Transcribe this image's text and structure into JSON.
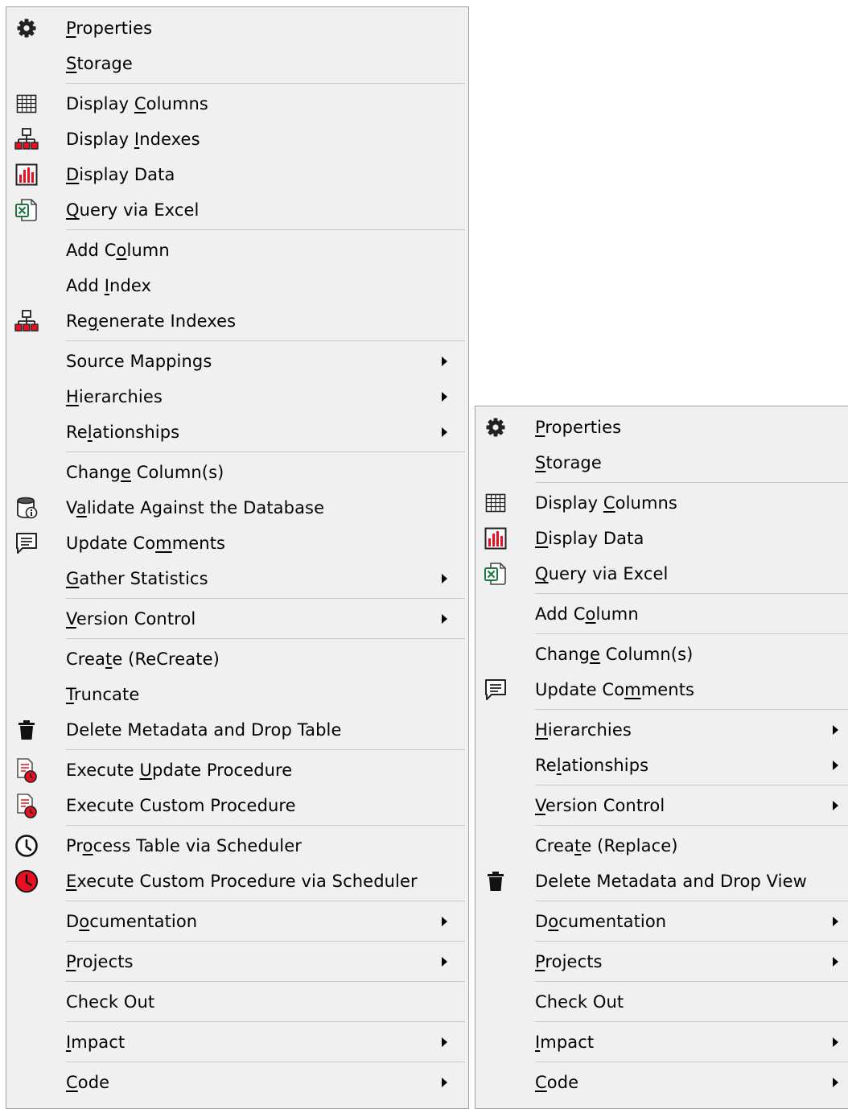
{
  "colors": {
    "menu_bg": "#f0f0f0",
    "border": "#a0a0a0",
    "separator": "#c8c8c8",
    "text": "#000000",
    "accent_red": "#e81123",
    "excel_green": "#217346"
  },
  "menus": [
    {
      "name": "table-context-menu",
      "items": [
        {
          "label": "Properties",
          "u": 0,
          "icon": "gear-icon"
        },
        {
          "label": "Storage",
          "u": 0,
          "icon": ""
        },
        {
          "sep": true
        },
        {
          "label": "Display Columns",
          "u": 8,
          "icon": "grid-icon"
        },
        {
          "label": "Display Indexes",
          "u": 8,
          "icon": "hierarchy-icon"
        },
        {
          "label": "Display Data",
          "u": 0,
          "icon": "bar-chart-icon"
        },
        {
          "label": "Query via Excel",
          "u": 0,
          "icon": "excel-icon"
        },
        {
          "sep": true
        },
        {
          "label": "Add Column",
          "u": 5,
          "icon": ""
        },
        {
          "label": "Add Index",
          "u": 4,
          "icon": ""
        },
        {
          "label": "Regenerate Indexes",
          "u": 2,
          "icon": "hierarchy-icon"
        },
        {
          "sep": true
        },
        {
          "label": "Source Mappings",
          "u": -1,
          "icon": "",
          "submenu": true
        },
        {
          "label": "Hierarchies",
          "u": 0,
          "icon": "",
          "submenu": true
        },
        {
          "label": "Relationships",
          "u": 2,
          "icon": "",
          "submenu": true
        },
        {
          "sep": true
        },
        {
          "label": "Change Column(s)",
          "u": 5,
          "icon": ""
        },
        {
          "label": "Validate Against the Database",
          "u": 1,
          "icon": "database-info-icon"
        },
        {
          "label": "Update Comments",
          "u": 9,
          "icon": "comment-icon"
        },
        {
          "label": "Gather Statistics",
          "u": 0,
          "icon": "",
          "submenu": true
        },
        {
          "sep": true
        },
        {
          "label": "Version Control",
          "u": 0,
          "icon": "",
          "submenu": true
        },
        {
          "sep": true
        },
        {
          "label": "Create (ReCreate)",
          "u": 4,
          "icon": ""
        },
        {
          "label": "Truncate",
          "u": 0,
          "icon": ""
        },
        {
          "label": "Delete Metadata and Drop Table",
          "u": -1,
          "icon": "trash-icon"
        },
        {
          "sep": true
        },
        {
          "label": "Execute Update Procedure",
          "u": 8,
          "icon": "procedure-run-icon"
        },
        {
          "label": "Execute Custom Procedure",
          "u": -1,
          "icon": "procedure-run-icon"
        },
        {
          "sep": true
        },
        {
          "label": "Process Table via Scheduler",
          "u": 2,
          "icon": "clock-icon"
        },
        {
          "label": "Execute Custom Procedure via Scheduler",
          "u": 0,
          "icon": "red-clock-icon"
        },
        {
          "sep": true
        },
        {
          "label": "Documentation",
          "u": 1,
          "icon": "",
          "submenu": true
        },
        {
          "sep": true
        },
        {
          "label": "Projects",
          "u": 0,
          "icon": "",
          "submenu": true
        },
        {
          "sep": true
        },
        {
          "label": "Check Out",
          "u": -1,
          "icon": ""
        },
        {
          "sep": true
        },
        {
          "label": "Impact",
          "u": 0,
          "icon": "",
          "submenu": true
        },
        {
          "sep": true
        },
        {
          "label": "Code",
          "u": 0,
          "icon": "",
          "submenu": true
        }
      ]
    },
    {
      "name": "view-context-menu",
      "items": [
        {
          "label": "Properties",
          "u": 0,
          "icon": "gear-icon"
        },
        {
          "label": "Storage",
          "u": 0,
          "icon": ""
        },
        {
          "sep": true
        },
        {
          "label": "Display Columns",
          "u": 8,
          "icon": "grid-icon"
        },
        {
          "label": "Display Data",
          "u": 0,
          "icon": "bar-chart-icon"
        },
        {
          "label": "Query via Excel",
          "u": 0,
          "icon": "excel-icon"
        },
        {
          "sep": true
        },
        {
          "label": "Add Column",
          "u": 5,
          "icon": ""
        },
        {
          "sep": true
        },
        {
          "label": "Change Column(s)",
          "u": 5,
          "icon": ""
        },
        {
          "label": "Update Comments",
          "u": 9,
          "icon": "comment-icon"
        },
        {
          "sep": true
        },
        {
          "label": "Hierarchies",
          "u": 0,
          "icon": "",
          "submenu": true
        },
        {
          "label": "Relationships",
          "u": 2,
          "icon": "",
          "submenu": true
        },
        {
          "sep": true
        },
        {
          "label": "Version Control",
          "u": 0,
          "icon": "",
          "submenu": true
        },
        {
          "sep": true
        },
        {
          "label": "Create (Replace)",
          "u": 4,
          "icon": ""
        },
        {
          "label": "Delete Metadata and Drop View",
          "u": -1,
          "icon": "trash-icon"
        },
        {
          "sep": true
        },
        {
          "label": "Documentation",
          "u": 1,
          "icon": "",
          "submenu": true
        },
        {
          "sep": true
        },
        {
          "label": "Projects",
          "u": 0,
          "icon": "",
          "submenu": true
        },
        {
          "sep": true
        },
        {
          "label": "Check Out",
          "u": -1,
          "icon": ""
        },
        {
          "sep": true
        },
        {
          "label": "Impact",
          "u": 0,
          "icon": "",
          "submenu": true
        },
        {
          "sep": true
        },
        {
          "label": "Code",
          "u": 0,
          "icon": "",
          "submenu": true
        }
      ]
    }
  ]
}
